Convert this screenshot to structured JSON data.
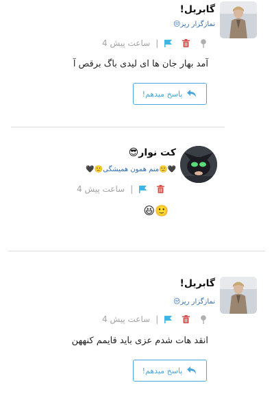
{
  "comments": [
    {
      "author": "گابریل!",
      "subtitle": "نمازگزار ریز😒",
      "time": "4 ساعت پیش",
      "text": "آمد بهار جان ها ای لیدی باگ برقص آ",
      "reply_label": "پاسخ میدهم!"
    },
    {
      "author": "کت نوار😎",
      "subtitle": "🖤🙂منم همون همیشگی🙂🖤",
      "time": "4 ساعت پیش",
      "text": "🙂😆"
    },
    {
      "author": "گابریل!",
      "subtitle": "نمازگزار ریز😒",
      "time": "4 ساعت پیش",
      "text": "انقد هات شدم عزی باید قایمم کنههن",
      "reply_label": "پاسخ میدهم!"
    }
  ],
  "colors": {
    "accent": "#4aa7dd",
    "flag": "#3db5e6",
    "trash": "#d9534f",
    "pin": "#b0b0b0",
    "link": "#2f6db5"
  },
  "icons": [
    "pin-icon",
    "trash-icon",
    "flag-icon",
    "reply-arrow-icon"
  ]
}
